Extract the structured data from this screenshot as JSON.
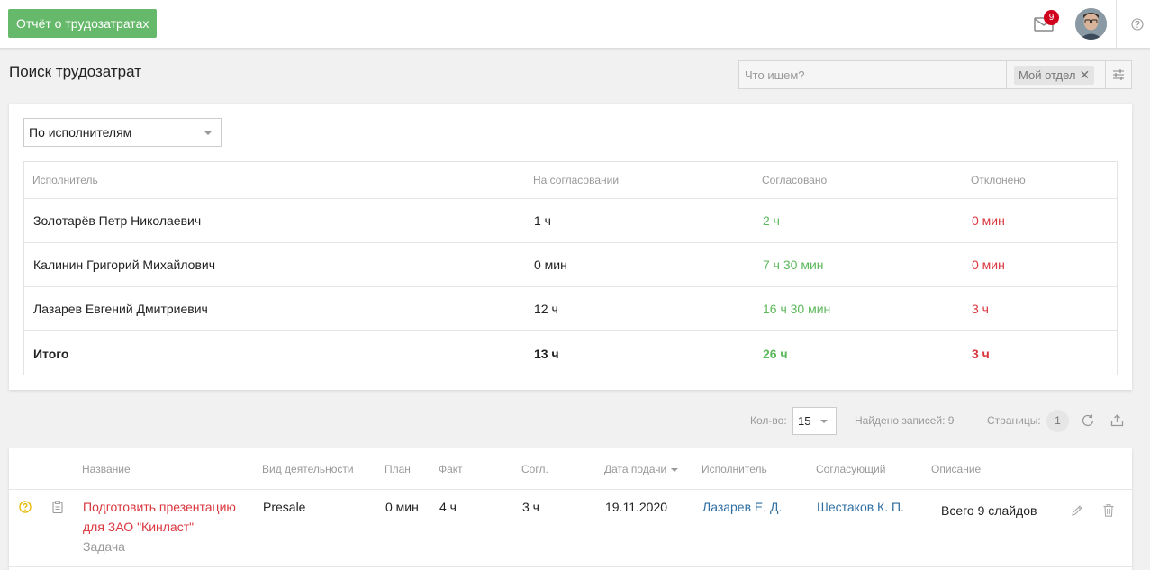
{
  "header": {
    "report_button_label": "Отчёт о трудозатратах",
    "notification_count": "9",
    "icons": {
      "mail": "mail-icon",
      "help": "help-icon",
      "avatar": "user-avatar"
    },
    "colors": {
      "accent": "#66b86a",
      "badge": "#d0021b"
    }
  },
  "page": {
    "title": "Поиск трудозатрат",
    "search": {
      "placeholder": "Что ищем?",
      "value": "",
      "filter_chip": "Мой отдел",
      "chip_close_glyph": "✕"
    }
  },
  "summary": {
    "group_by_value": "По исполнителям",
    "columns": [
      "Исполнитель",
      "На согласовании",
      "Согласовано",
      "Отклонено"
    ],
    "rows": [
      {
        "name": "Золотарёв Петр Николаевич",
        "pending": "1 ч",
        "approved": "2 ч",
        "rejected": "0 мин"
      },
      {
        "name": "Калинин Григорий Михайлович",
        "pending": "0 мин",
        "approved": "7 ч 30 мин",
        "rejected": "0 мин"
      },
      {
        "name": "Лазарев Евгений Дмитриевич",
        "pending": "12 ч",
        "approved": "16 ч 30 мин",
        "rejected": "3 ч"
      }
    ],
    "total": {
      "label": "Итого",
      "pending": "13 ч",
      "approved": "26 ч",
      "rejected": "3 ч"
    },
    "colors": {
      "approved": "#5cb85c",
      "rejected": "#d9363e"
    }
  },
  "pagination": {
    "qty_label": "Кол-во:",
    "qty_value": "15",
    "found_label": "Найдено записей:",
    "found_value": "9",
    "pages_label": "Страницы:",
    "current_page": "1"
  },
  "records": {
    "columns": {
      "name": "Название",
      "activity": "Вид деятельности",
      "plan": "План",
      "fact": "Факт",
      "agreed": "Согл.",
      "date": "Дата подачи",
      "executor": "Исполнитель",
      "approver": "Согласующий",
      "description": "Описание"
    },
    "rows": [
      {
        "title": "Подготовить презентацию для ЗАО \"Кинласт\"",
        "type": "Задача",
        "activity": "Presale",
        "plan": "0 мин",
        "fact": "4 ч",
        "agreed": "3 ч",
        "date": "19.11.2020",
        "executor": "Лазарев Е. Д.",
        "approver": "Шестаков К. П.",
        "description": "Всего 9 слайдов",
        "status_icon": "question-circle-icon"
      }
    ]
  }
}
